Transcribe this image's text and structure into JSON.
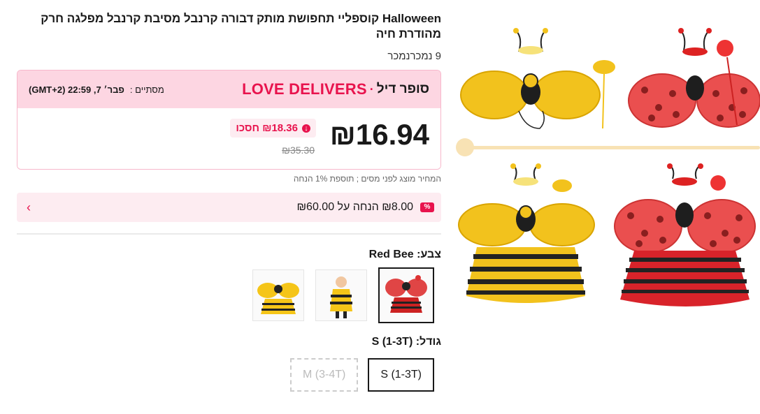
{
  "product": {
    "title": "Halloween קוספליי תחפושת מותק דבורה קרנבל מסיבת קרנבל מפלגה חרק מהודרת חיה",
    "sold": "9 נמכרנמכר"
  },
  "deal": {
    "brand": "LOVE DELIVERS",
    "separator": "·",
    "type": "סופר דיל",
    "ends_label": "מסתיים :",
    "ends_value": "פבר׳ 7, 22:59 (GMT+2)",
    "price": "₪16.94",
    "save_text": "₪18.36 חסכו",
    "original_price": "₪35.30"
  },
  "tax_note": "המחיר מוצג לפני מסים ; תוספת 1% הנחה",
  "coupon": {
    "badge": "%",
    "text": "₪8.00 הנחה על ₪60.00",
    "chevron": "›"
  },
  "color": {
    "label": "צבע: Red Bee",
    "options": [
      "Yellow Bee Set",
      "Bee Dress",
      "Red Bee"
    ],
    "selected_index": 2
  },
  "size": {
    "label": "גודל: S (1-3T)",
    "options": [
      {
        "label": "S (1-3T)",
        "disabled": false
      },
      {
        "label": "M (3-4T)",
        "disabled": true
      }
    ]
  },
  "gallery": {
    "slider_value": 0
  },
  "colors": {
    "accent": "#e8134d",
    "deal_bg": "#fdd6e2",
    "coupon_bg": "#fdecf1",
    "slider": "#f8e2b4"
  }
}
